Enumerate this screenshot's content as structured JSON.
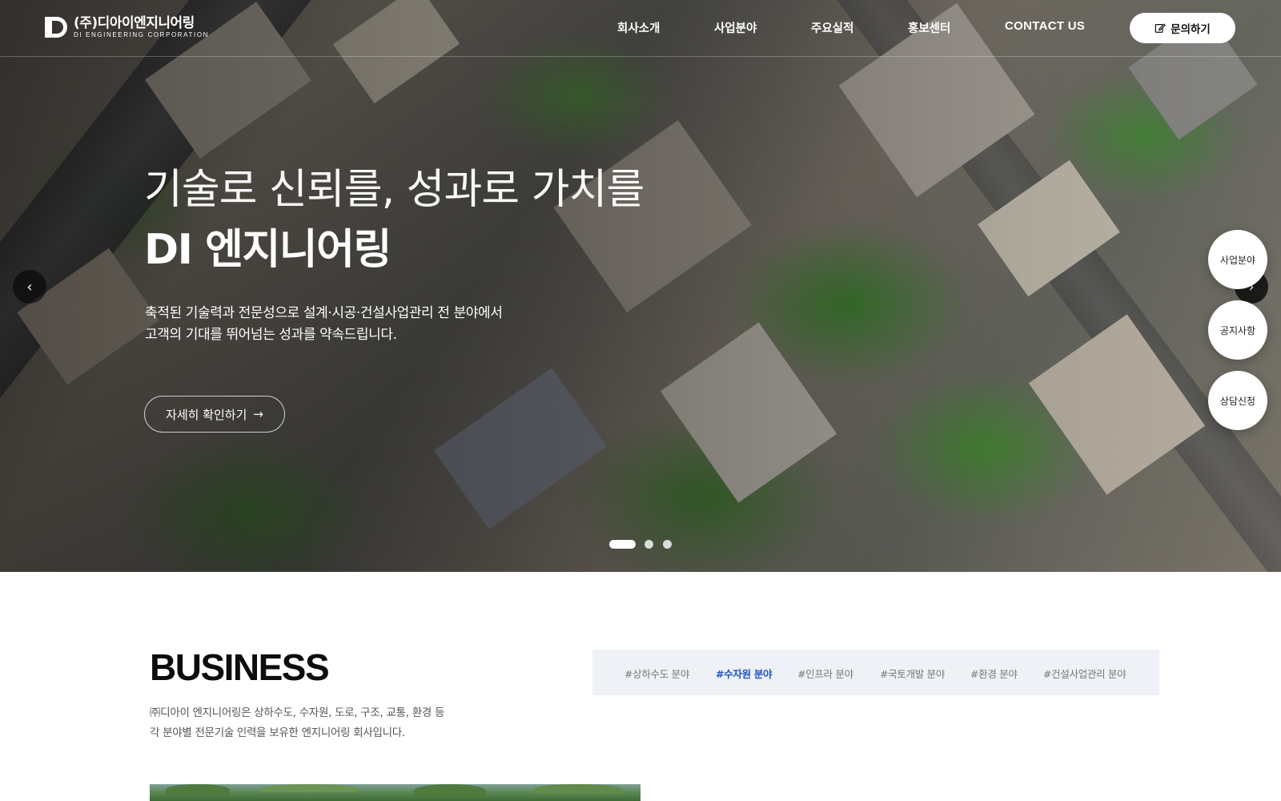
{
  "header": {
    "logo": {
      "name_kr": "(주)디아이엔지니어링",
      "name_en": "DI ENGINEERING CORPORATION"
    },
    "nav": [
      {
        "label": "회사소개"
      },
      {
        "label": "사업분야"
      },
      {
        "label": "주요실적"
      },
      {
        "label": "홍보센터"
      },
      {
        "label": "CONTACT US"
      }
    ],
    "inquiry_label": "문의하기"
  },
  "hero": {
    "title_line1": "기술로 신뢰를, 성과로 가치를",
    "title_line2": "DI 엔지니어링",
    "desc_line1": "축적된 기술력과 전문성으로 설계·시공·건설사업관리 전 분야에서",
    "desc_line2": "고객의 기대를 뛰어넘는 성과를 약속드립니다.",
    "cta_label": "자세히 확인하기",
    "slide_count": 3,
    "active_slide": 1
  },
  "quick_menu": [
    {
      "label": "사업분야"
    },
    {
      "label": "공지사항"
    },
    {
      "label": "상담신청"
    }
  ],
  "business": {
    "title": "BUSINESS",
    "desc_line1": "㈜디아이 엔지니어링은 상하수도, 수자원, 도로, 구조, 교통, 환경 등",
    "desc_line2": "각 분야별 전문기술 인력을 보유한 엔지니어링 회사입니다.",
    "tabs": [
      {
        "label": "#상하수도 분야",
        "active": false
      },
      {
        "label": "#수자원 분야",
        "active": true
      },
      {
        "label": "#인프라 분야",
        "active": false
      },
      {
        "label": "#국토개발 분야",
        "active": false
      },
      {
        "label": "#환경 분야",
        "active": false
      },
      {
        "label": "#건설사업관리 분야",
        "active": false
      }
    ]
  },
  "colors": {
    "accent": "#1e50c8",
    "tab_bg": "#eef1f5",
    "text_dark": "#0d0d0d",
    "text_muted": "#555555"
  },
  "icons": {
    "inquiry": "edit-icon",
    "cta": "arrow-right-icon",
    "prev": "chevron-left-icon",
    "next": "chevron-right-icon"
  }
}
